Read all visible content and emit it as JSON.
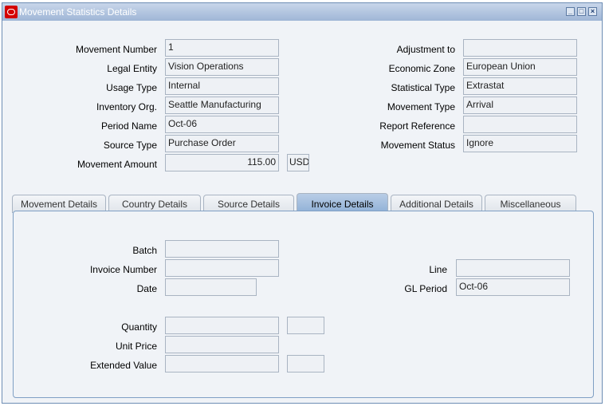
{
  "window": {
    "title": "Movement Statistics Details"
  },
  "header_fields": {
    "movement_number": {
      "label": "Movement Number",
      "value": "1"
    },
    "legal_entity": {
      "label": "Legal Entity",
      "value": "Vision Operations"
    },
    "usage_type": {
      "label": "Usage Type",
      "value": "Internal"
    },
    "inventory_org": {
      "label": "Inventory Org.",
      "value": "Seattle Manufacturing"
    },
    "period_name": {
      "label": "Period Name",
      "value": "Oct-06"
    },
    "source_type": {
      "label": "Source Type",
      "value": "Purchase Order"
    },
    "movement_amount": {
      "label": "Movement Amount",
      "value": "115.00",
      "currency": "USD"
    },
    "adjustment_to": {
      "label": "Adjustment to",
      "value": ""
    },
    "economic_zone": {
      "label": "Economic Zone",
      "value": "European Union"
    },
    "statistical_type": {
      "label": "Statistical Type",
      "value": "Extrastat"
    },
    "movement_type": {
      "label": "Movement Type",
      "value": "Arrival"
    },
    "report_reference": {
      "label": "Report Reference",
      "value": ""
    },
    "movement_status": {
      "label": "Movement Status",
      "value": "Ignore"
    }
  },
  "tabs": [
    {
      "label": "Movement Details",
      "active": false
    },
    {
      "label": "Country Details",
      "active": false
    },
    {
      "label": "Source Details",
      "active": false
    },
    {
      "label": "Invoice Details",
      "active": true
    },
    {
      "label": "Additional Details",
      "active": false
    },
    {
      "label": "Miscellaneous",
      "active": false
    }
  ],
  "invoice_panel": {
    "batch": {
      "label": "Batch",
      "value": ""
    },
    "invoice_number": {
      "label": "Invoice Number",
      "value": ""
    },
    "date": {
      "label": "Date",
      "value": ""
    },
    "line": {
      "label": "Line",
      "value": ""
    },
    "gl_period": {
      "label": "GL Period",
      "value": "Oct-06"
    },
    "quantity": {
      "label": "Quantity",
      "value": "",
      "uom": ""
    },
    "unit_price": {
      "label": "Unit Price",
      "value": ""
    },
    "extended_value": {
      "label": "Extended Value",
      "value": "",
      "currency": ""
    }
  }
}
